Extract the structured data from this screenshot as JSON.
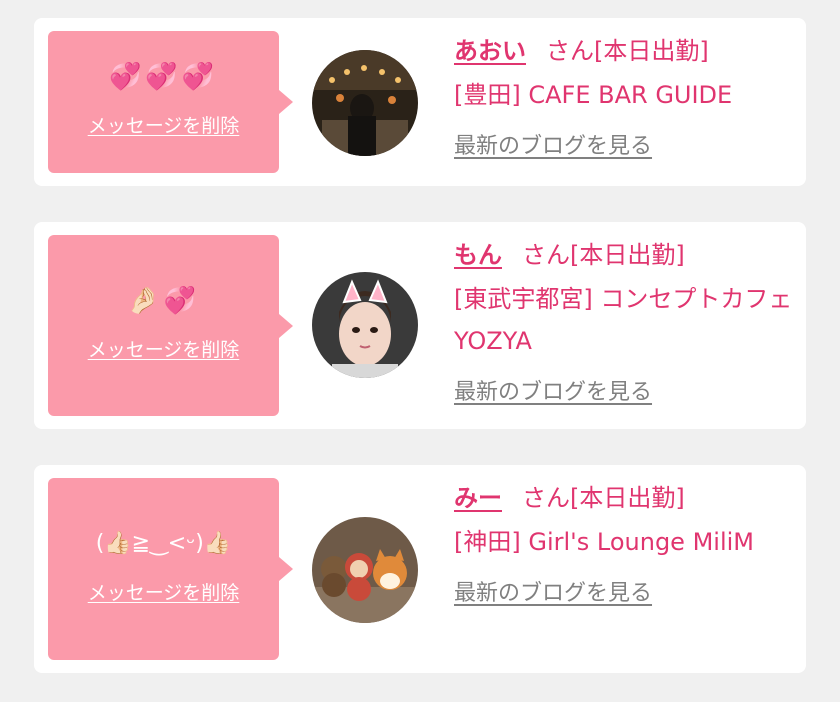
{
  "entries": [
    {
      "message_emoji": "💞💞💞",
      "delete_label": "メッセージを削除",
      "cast_name": "あおい",
      "status": "さん[本日出勤]",
      "shop": "[豊田] CAFE BAR GUIDE",
      "blog_link": "最新のブログを見る",
      "avatar_icon": "avatar-photo-cafe"
    },
    {
      "message_emoji": "🤌🏻💞",
      "delete_label": "メッセージを削除",
      "cast_name": "もん",
      "status": "さん[本日出勤]",
      "shop": "[東武宇都宮] コンセプトカフェYOZYA",
      "blog_link": "最新のブログを見る",
      "avatar_icon": "avatar-photo-cat-ears"
    },
    {
      "message_emoji": "(👍🏻≧‿<ᵕ)👍🏻",
      "delete_label": "メッセージを削除",
      "cast_name": "みー",
      "status": "さん[本日出勤]",
      "shop": "[神田] Girl's Lounge MiliM",
      "blog_link": "最新のブログを見る",
      "avatar_icon": "avatar-photo-plush-toys"
    }
  ]
}
